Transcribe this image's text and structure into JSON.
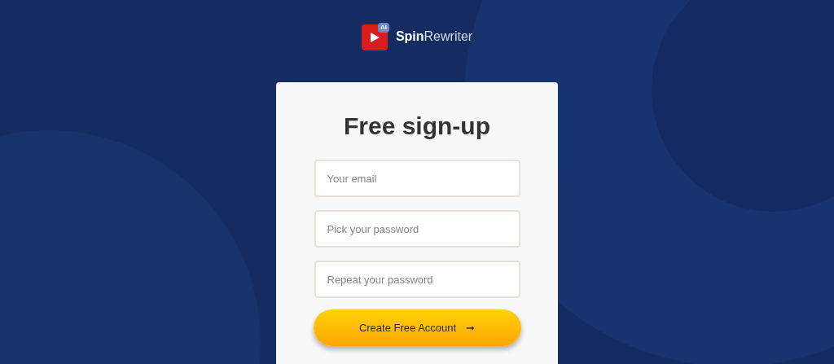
{
  "logo": {
    "badge": "AI",
    "wordmark": "**Spin**Rewriter"
  },
  "form": {
    "title": "Free sign-up",
    "fields": [
      {
        "placeholder": "Your email"
      },
      {
        "placeholder": "Pick your password"
      },
      {
        "placeholder": "Repeat your password"
      }
    ],
    "submit": {
      "label": "Create Free Account",
      "arrow": "➞"
    }
  }
}
